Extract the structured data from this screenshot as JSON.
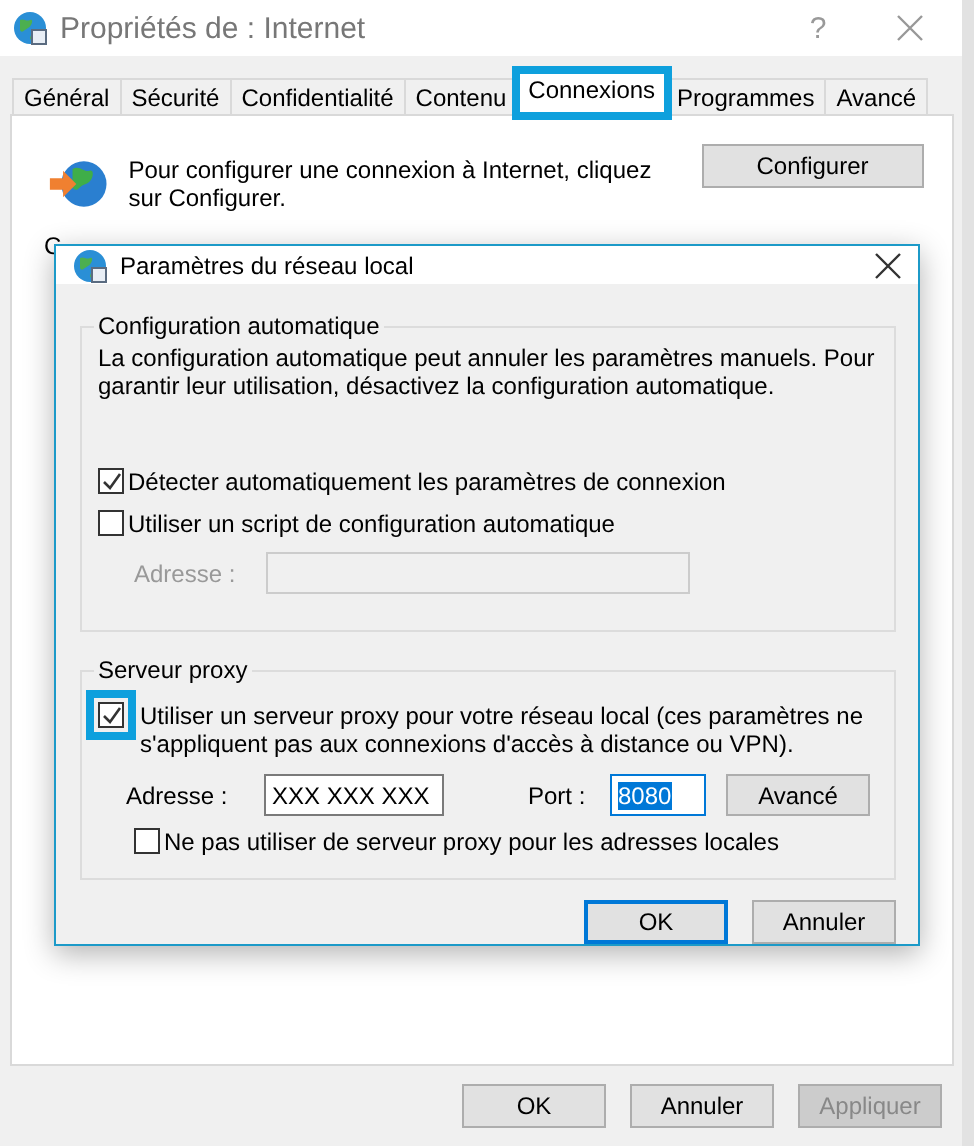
{
  "window": {
    "title": "Propriétés de : Internet",
    "help": "?"
  },
  "tabs": [
    {
      "label": "Général",
      "selected": false,
      "highlighted": false
    },
    {
      "label": "Sécurité",
      "selected": false,
      "highlighted": false
    },
    {
      "label": "Confidentialité",
      "selected": false,
      "highlighted": false
    },
    {
      "label": "Contenu",
      "selected": false,
      "highlighted": false
    },
    {
      "label": "Connexions",
      "selected": true,
      "highlighted": true
    },
    {
      "label": "Programmes",
      "selected": false,
      "highlighted": false
    },
    {
      "label": "Avancé",
      "selected": false,
      "highlighted": false
    }
  ],
  "setup": {
    "text": "Pour configurer une connexion à Internet, cliquez sur Configurer.",
    "button": "Configurer"
  },
  "hidden_labels": [
    "C"
  ],
  "dialog": {
    "title": "Paramètres du réseau local",
    "auto_group": {
      "title": "Configuration automatique",
      "text": "La configuration automatique peut annuler les paramètres manuels. Pour garantir leur utilisation, désactivez la configuration automatique.",
      "options": [
        {
          "label": "Détecter automatiquement les paramètres de connexion",
          "checked": true
        },
        {
          "label": "Utiliser un script de configuration automatique",
          "checked": false
        }
      ],
      "address": {
        "label": "Adresse :",
        "disabled": true
      }
    },
    "proxy_group": {
      "title": "Serveur proxy",
      "use_proxy": {
        "label": "Utiliser un serveur proxy pour votre réseau local (ces paramètres ne s'appliquent pas aux connexions d'accès à distance ou VPN).",
        "checked": true,
        "highlighted": true
      },
      "address": {
        "label": "Adresse :",
        "value": "XXX XXX XXX"
      },
      "port": {
        "label": "Port :",
        "value": "8080",
        "text_selected": true
      },
      "advanced": "Avancé",
      "bypass": {
        "label": "Ne pas utiliser de serveur proxy pour les adresses locales",
        "checked": false
      }
    },
    "buttons": [
      {
        "label": "OK",
        "default": true
      },
      {
        "label": "Annuler",
        "default": false
      }
    ]
  },
  "buttons": [
    {
      "label": "OK",
      "disabled": false
    },
    {
      "label": "Annuler",
      "disabled": false
    },
    {
      "label": "Appliquer",
      "disabled": true
    }
  ]
}
